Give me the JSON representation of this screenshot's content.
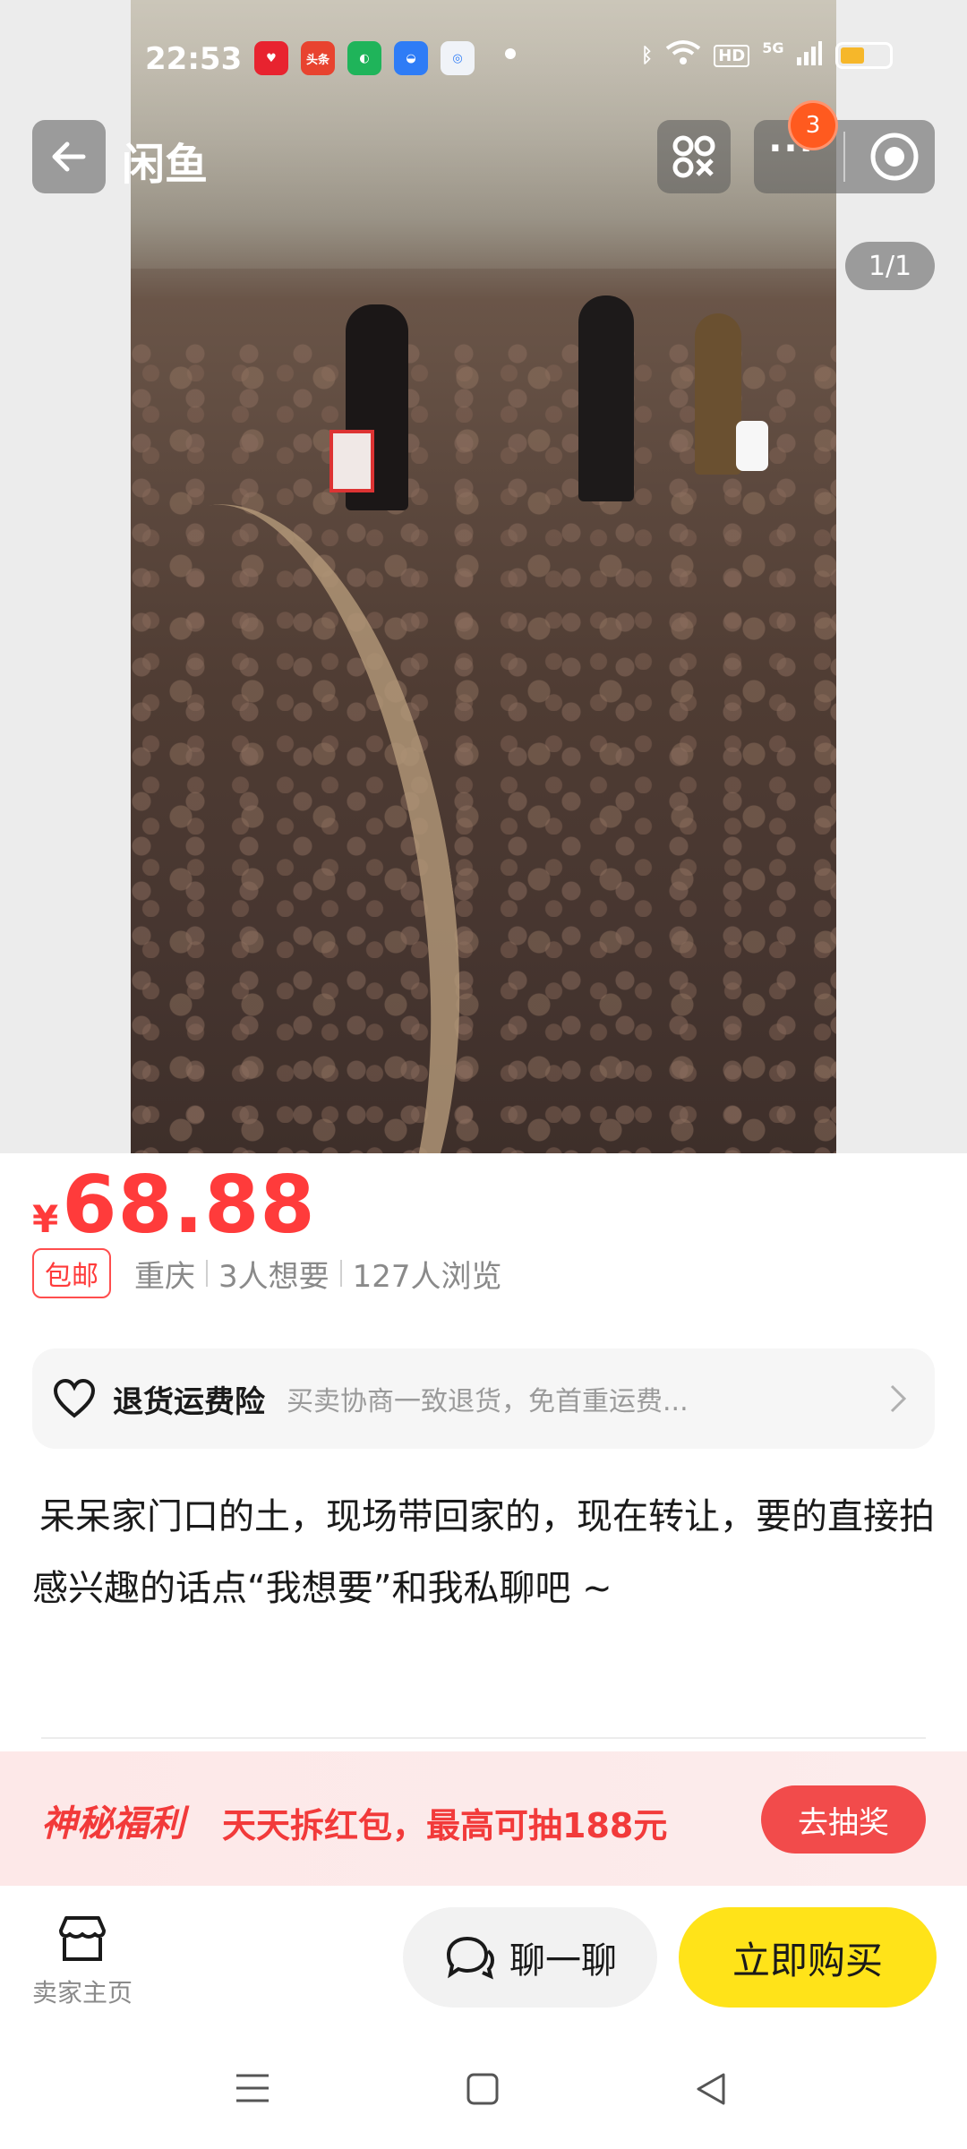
{
  "status_bar": {
    "time": "22:53",
    "apps": [
      {
        "name": "app-badge-red",
        "label": "",
        "color": "#e8232f"
      },
      {
        "name": "app-badge-toutiao",
        "label": "头条",
        "color": "#e8432f"
      },
      {
        "name": "app-badge-green",
        "label": "",
        "color": "#1fb45a"
      },
      {
        "name": "app-badge-blue",
        "label": "",
        "color": "#2e7cf6"
      },
      {
        "name": "app-badge-search",
        "label": "",
        "color": "#f0f3f8"
      }
    ],
    "hd_label": "HD",
    "signal_label": "5G"
  },
  "header": {
    "title": "闲鱼",
    "badge_count": "3",
    "page_indicator": "1/1"
  },
  "product": {
    "currency": "¥",
    "price": "68.88",
    "free_shipping_tag": "包邮",
    "location": "重庆",
    "wants": "3人想要",
    "views": "127人浏览"
  },
  "insurance": {
    "title": "退货运费险",
    "description": "买卖协商一致退货，免首重运费..."
  },
  "description": {
    "line1": "呆呆家门口的土，现场带回家的，现在转让，要的直接拍",
    "line2": "感兴趣的话点“我想要”和我私聊吧 ~"
  },
  "promo": {
    "brand": "神秘福利",
    "text": "天天拆红包，最高可抽188元",
    "button": "去抽奖"
  },
  "bottom_bar": {
    "seller_label": "卖家主页",
    "chat_label": "聊一聊",
    "buy_label": "立即购买"
  },
  "colors": {
    "price": "#ff3b3b",
    "buy_button": "#ffe319",
    "promo_button": "#f24b4b"
  }
}
